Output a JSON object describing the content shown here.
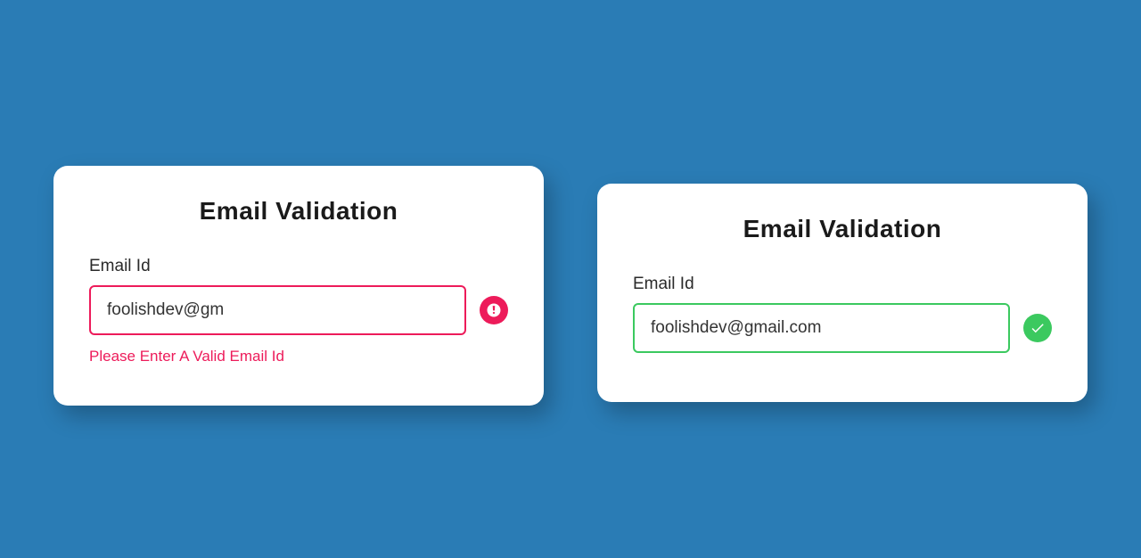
{
  "card_invalid": {
    "title": "Email Validation",
    "label": "Email Id",
    "input_value": "foolishdev@gm",
    "error_message": "Please Enter A Valid Email Id"
  },
  "card_valid": {
    "title": "Email Validation",
    "label": "Email Id",
    "input_value": "foolishdev@gmail.com"
  }
}
